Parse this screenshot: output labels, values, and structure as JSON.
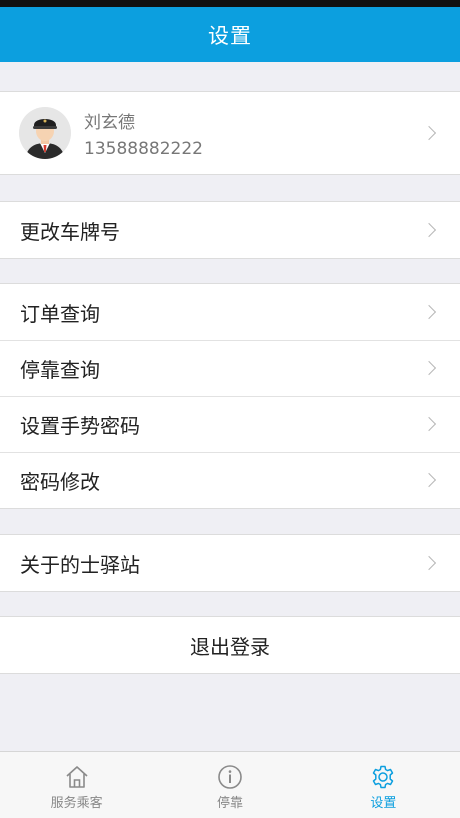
{
  "header": {
    "title": "设置"
  },
  "profile": {
    "name": "刘玄德",
    "phone": "13588882222"
  },
  "menu": {
    "plate": "更改车牌号",
    "orders": "订单查询",
    "parking": "停靠查询",
    "gesture": "设置手势密码",
    "password": "密码修改",
    "about": "关于的士驿站",
    "logout": "退出登录"
  },
  "tabs": [
    {
      "label": "服务乘客",
      "icon": "home-icon"
    },
    {
      "label": "停靠",
      "icon": "info-icon"
    },
    {
      "label": "设置",
      "icon": "gear-icon",
      "active": true
    }
  ],
  "colors": {
    "accent": "#0c9fdf",
    "background": "#efeff4",
    "status_bar": "#111111"
  }
}
